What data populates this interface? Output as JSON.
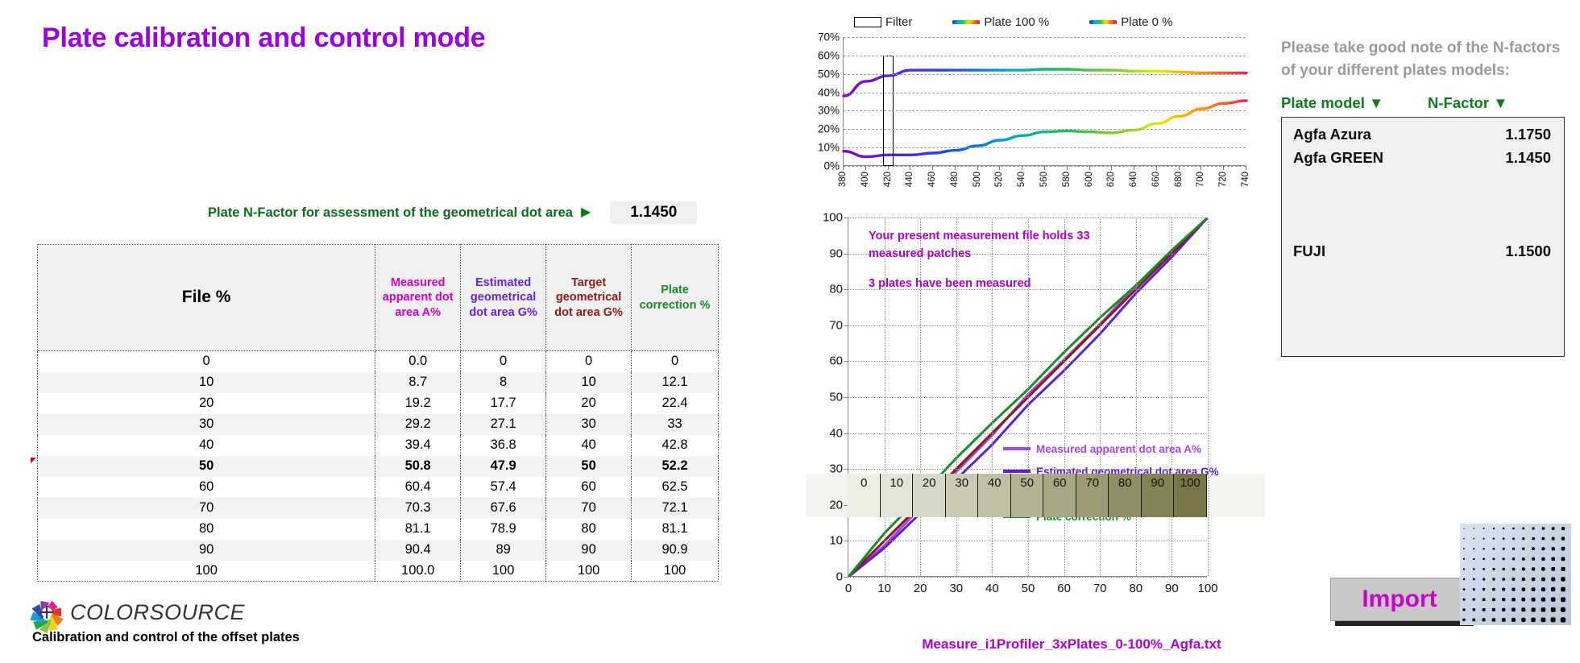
{
  "page_title": "Plate calibration and control mode",
  "nfactor": {
    "label": "Plate N-Factor for assessment of the geometrical dot area",
    "arrow": "▶",
    "value": "1.1450"
  },
  "table": {
    "headers": {
      "file": "File %",
      "measured": "Measured apparent dot area A%",
      "estimated": "Estimated geometrical dot area G%",
      "target": "Target geometrical dot area G%",
      "correction": "Plate correction %"
    },
    "header_lines": {
      "measured": [
        "Measured",
        "apparent dot",
        "area A%"
      ],
      "estimated": [
        "Estimated",
        "geometrical",
        "dot area G%"
      ],
      "target": [
        "Target",
        "geometrical",
        "dot area G%"
      ],
      "correction": [
        "Plate",
        "correction %"
      ]
    },
    "rows": [
      {
        "file": "0",
        "measured": "0.0",
        "estimated": "0",
        "target": "0",
        "correction": "0",
        "bold": false
      },
      {
        "file": "10",
        "measured": "8.7",
        "estimated": "8",
        "target": "10",
        "correction": "12.1",
        "bold": false
      },
      {
        "file": "20",
        "measured": "19.2",
        "estimated": "17.7",
        "target": "20",
        "correction": "22.4",
        "bold": false
      },
      {
        "file": "30",
        "measured": "29.2",
        "estimated": "27.1",
        "target": "30",
        "correction": "33",
        "bold": false
      },
      {
        "file": "40",
        "measured": "39.4",
        "estimated": "36.8",
        "target": "40",
        "correction": "42.8",
        "bold": false
      },
      {
        "file": "50",
        "measured": "50.8",
        "estimated": "47.9",
        "target": "50",
        "correction": "52.2",
        "bold": true
      },
      {
        "file": "60",
        "measured": "60.4",
        "estimated": "57.4",
        "target": "60",
        "correction": "62.5",
        "bold": false
      },
      {
        "file": "70",
        "measured": "70.3",
        "estimated": "67.6",
        "target": "70",
        "correction": "72.1",
        "bold": false
      },
      {
        "file": "80",
        "measured": "81.1",
        "estimated": "78.9",
        "target": "80",
        "correction": "81.1",
        "bold": false
      },
      {
        "file": "90",
        "measured": "90.4",
        "estimated": "89",
        "target": "90",
        "correction": "90.9",
        "bold": false
      },
      {
        "file": "100",
        "measured": "100.0",
        "estimated": "100",
        "target": "100",
        "correction": "100",
        "bold": false
      }
    ]
  },
  "logo": {
    "brand": "COLORSOURCE",
    "subtitle": "Calibration and control of the offset plates"
  },
  "chart_data": [
    {
      "type": "line",
      "name": "spectral-reflectance-chart",
      "title": "",
      "xlabel": "",
      "ylabel": "",
      "xlim": [
        380,
        740
      ],
      "ylim": [
        0,
        70
      ],
      "grid": true,
      "legend_position": "top",
      "ytick_labels": [
        "0%",
        "10%",
        "20%",
        "30%",
        "40%",
        "50%",
        "60%",
        "70%"
      ],
      "yticks": [
        0,
        10,
        20,
        30,
        40,
        50,
        60,
        70
      ],
      "xticks": [
        380,
        400,
        420,
        440,
        460,
        480,
        500,
        520,
        540,
        560,
        580,
        600,
        620,
        640,
        660,
        680,
        700,
        720,
        740
      ],
      "legend": [
        {
          "label": "Filter",
          "style": "box"
        },
        {
          "label": "Plate 100 %",
          "style": "rainbow"
        },
        {
          "label": "Plate 0 %",
          "style": "rainbow"
        }
      ],
      "annotations": [
        {
          "label": "filter band",
          "x_range": [
            415,
            425
          ],
          "y_range": [
            0,
            60
          ]
        }
      ],
      "x": [
        380,
        400,
        420,
        440,
        460,
        480,
        500,
        520,
        540,
        560,
        580,
        600,
        620,
        640,
        660,
        680,
        700,
        720,
        740
      ],
      "series": [
        {
          "name": "Plate 100 %",
          "values": [
            38,
            46,
            49,
            52,
            52,
            52,
            52,
            52,
            52,
            52.5,
            52.5,
            52,
            52,
            51.5,
            51.5,
            51,
            50.5,
            50.5,
            50.5
          ]
        },
        {
          "name": "Plate 0 %",
          "values": [
            8,
            5,
            6,
            6,
            7,
            8.5,
            11,
            14,
            16.5,
            18.5,
            19,
            18.5,
            18,
            19.5,
            23,
            27,
            31,
            34,
            35.5
          ]
        }
      ]
    },
    {
      "type": "line",
      "name": "dot-area-transfer-chart",
      "title": "",
      "xlabel": "",
      "ylabel": "",
      "xlim": [
        0,
        100
      ],
      "ylim": [
        0,
        100
      ],
      "grid": true,
      "legend_position": "inside-bottom-right",
      "yticks": [
        0,
        10,
        20,
        30,
        40,
        50,
        60,
        70,
        80,
        90,
        100
      ],
      "xticks": [
        0,
        10,
        20,
        30,
        40,
        50,
        60,
        70,
        80,
        90,
        100
      ],
      "x": [
        0,
        10,
        20,
        30,
        40,
        50,
        60,
        70,
        80,
        90,
        100
      ],
      "series": [
        {
          "name": "Measured apparent dot area A%",
          "values": [
            0,
            8.7,
            19.2,
            29.2,
            39.4,
            50.8,
            60.4,
            70.3,
            81.1,
            90.4,
            100.0
          ],
          "color": "#a347e0"
        },
        {
          "name": "Estimated geometrical dot area G%",
          "values": [
            0,
            8,
            17.7,
            27.1,
            36.8,
            47.9,
            57.4,
            67.6,
            78.9,
            89,
            100
          ],
          "color": "#5b1fd6"
        },
        {
          "name": "Target geometrical dot area G%",
          "values": [
            0,
            10,
            20,
            30,
            40,
            50,
            60,
            70,
            80,
            90,
            100
          ],
          "color": "#8b1a1a"
        },
        {
          "name": "Plate correction %",
          "values": [
            0,
            12.1,
            22.4,
            33,
            42.8,
            52.2,
            62.5,
            72.1,
            81.1,
            90.9,
            100
          ],
          "color": "#1a8a2a"
        }
      ],
      "annotations": [
        "Your present measurement file holds 33 measured patches",
        "3 plates have been measured"
      ]
    }
  ],
  "xy_notes": [
    "Your present measurement file holds 33 measured patches",
    "3 plates have been measured"
  ],
  "gradient_strip": {
    "labels": [
      "0",
      "10",
      "20",
      "30",
      "40",
      "50",
      "60",
      "70",
      "80",
      "90",
      "100"
    ]
  },
  "filename": "Measure_i1Profiler_3xPlates_0-100%_Agfa.txt",
  "right_panel": {
    "note": "Please take good note of the N-factors of your different plates models:",
    "headers": {
      "plate_model": "Plate model ▼",
      "n_factor": "N-Factor ▼"
    },
    "plates": [
      {
        "model": "Agfa Azura",
        "factor": "1.1750"
      },
      {
        "model": "Agfa GREEN",
        "factor": "1.1450"
      },
      {
        "model": "",
        "factor": ""
      },
      {
        "model": "",
        "factor": ""
      },
      {
        "model": "",
        "factor": ""
      },
      {
        "model": "FUJI",
        "factor": "1.1500"
      }
    ]
  },
  "import_button": "Import",
  "colors": {
    "title_purple": "#9900dd",
    "green": "#0d7a22",
    "measured": "#bb00bb",
    "estimated": "#5b1fd6",
    "target": "#8b1a1a",
    "correction": "#1a7a2a"
  }
}
